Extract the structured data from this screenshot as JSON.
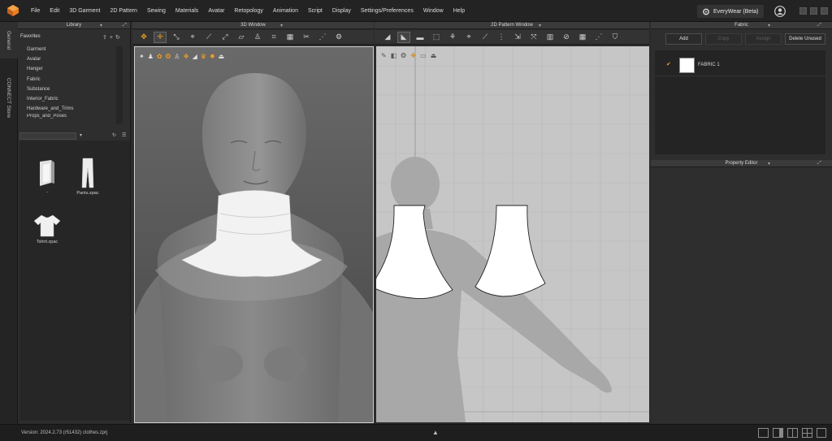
{
  "menu": {
    "items": [
      "File",
      "Edit",
      "3D Garment",
      "2D Pattern",
      "Sewing",
      "Materials",
      "Avatar",
      "Retopology",
      "Animation",
      "Script",
      "Display",
      "Settings/Preferences",
      "Window",
      "Help"
    ],
    "brand": "EveryWear (Beta)"
  },
  "side_tabs": [
    "General",
    "CONNECT Store"
  ],
  "library": {
    "title": "Library",
    "section": "Favorites",
    "tree": [
      "Garment",
      "Avatar",
      "Hanger",
      "Fabric",
      "Substance",
      "Interior_Fabric",
      "Hardware_and_Trims",
      "Props_and_Poses"
    ],
    "files": [
      {
        "label": "..",
        "icon": "folder-icon"
      },
      {
        "label": "Pants.zpac",
        "icon": "pants-icon"
      },
      {
        "label": "Tshirt.zpac",
        "icon": "tshirt-icon"
      }
    ]
  },
  "view3d": {
    "title": "3D Window"
  },
  "view2d": {
    "title": "2D Pattern Window"
  },
  "fabric": {
    "title": "Fabric",
    "buttons": {
      "add": "Add",
      "copy": "Copy",
      "assign": "Assign",
      "delete_unused": "Delete Unused"
    },
    "items": [
      {
        "name": "FABRIC 1",
        "color": "#ffffff",
        "checked": true
      }
    ]
  },
  "property_editor": {
    "title": "Property Editor"
  },
  "status": {
    "text": "Version:   2024.2.73 (r51432)   clothes.zprj"
  },
  "colors": {
    "accent": "#f0a020",
    "background": "#2b2b2b",
    "pattern_fill": "#ffffff",
    "grid_bg": "#c6c6c6"
  }
}
